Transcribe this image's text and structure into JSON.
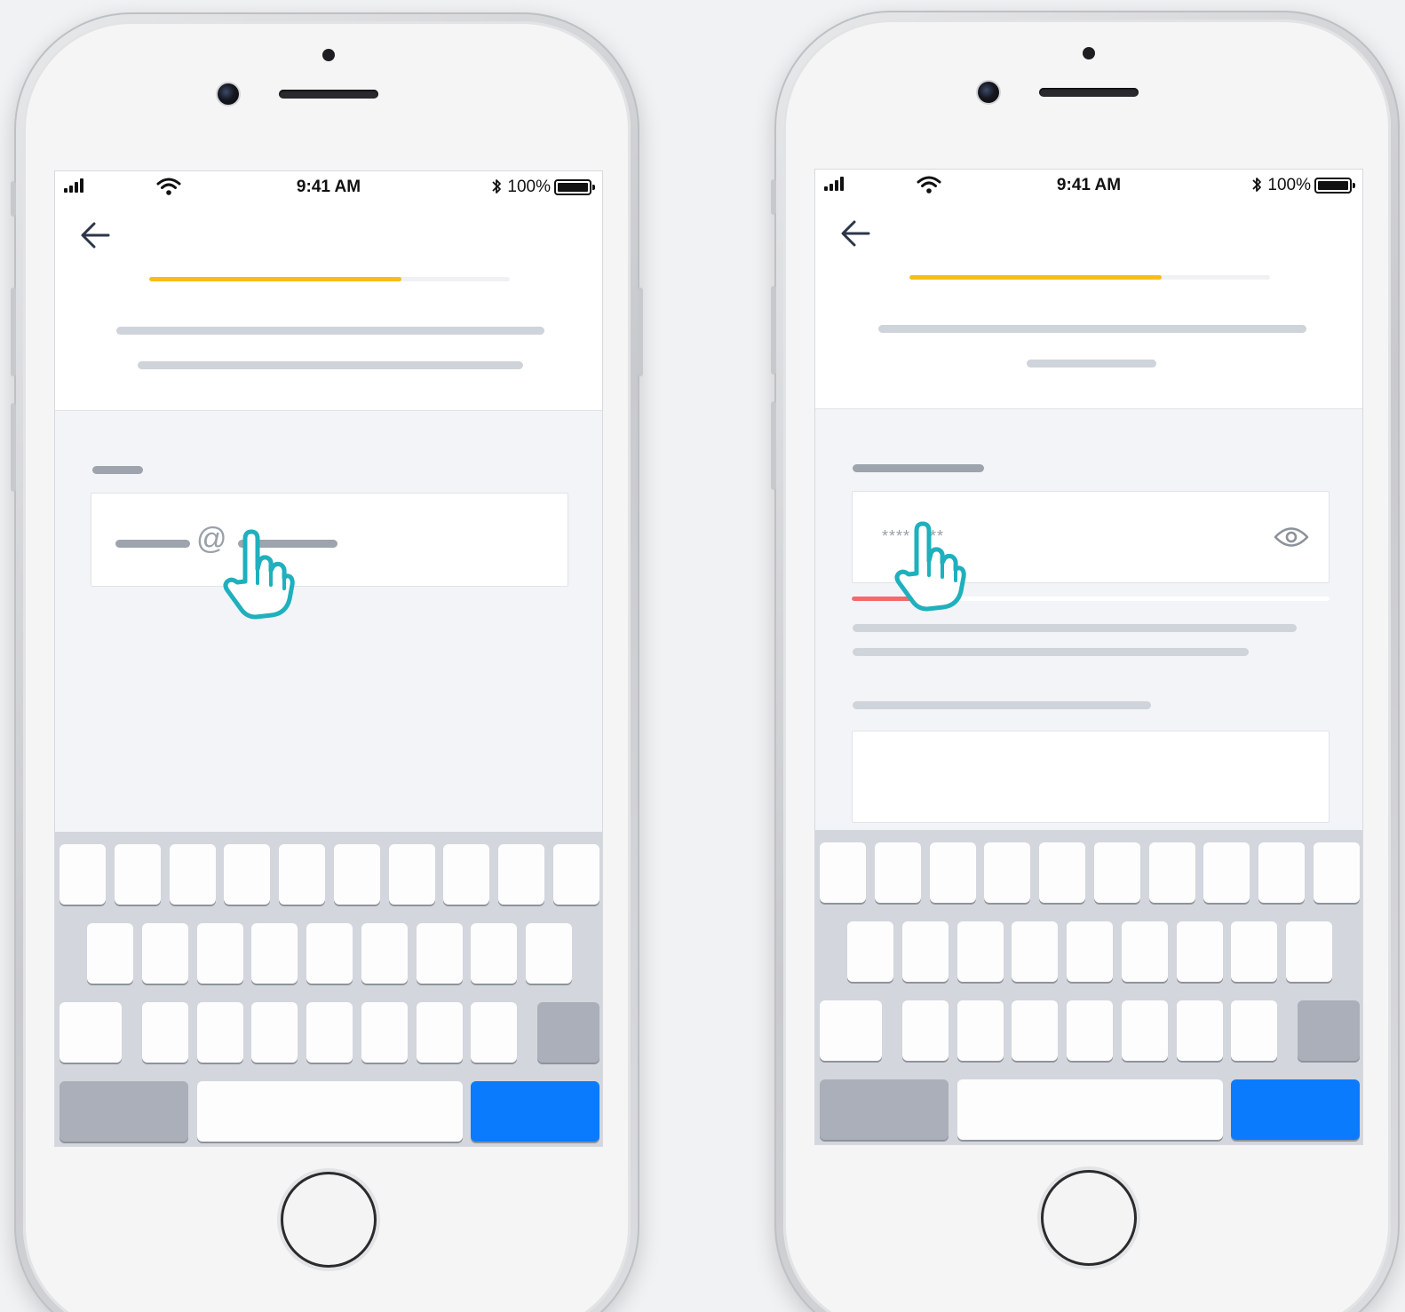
{
  "status_bar": {
    "time": "9:41 AM",
    "battery_percent": "100%"
  },
  "screens": [
    {
      "id": "email-step",
      "progress_fraction": 0.7,
      "field_symbol": "@"
    },
    {
      "id": "password-step",
      "progress_fraction": 0.7,
      "password_mask": "**** ****",
      "password_strength_fraction": 0.22
    }
  ],
  "icons": {
    "back": "arrow-left-icon",
    "signal": "signal-bars-icon",
    "wifi": "wifi-icon",
    "bluetooth": "bluetooth-icon",
    "battery": "battery-icon",
    "visibility": "eye-icon",
    "pointer": "hand-pointer-icon"
  },
  "colors": {
    "progress": "#f9bd15",
    "strength_weak": "#f5686c",
    "keyboard_action": "#0a7bfd",
    "pointer_hand": "#1fb0bd"
  }
}
